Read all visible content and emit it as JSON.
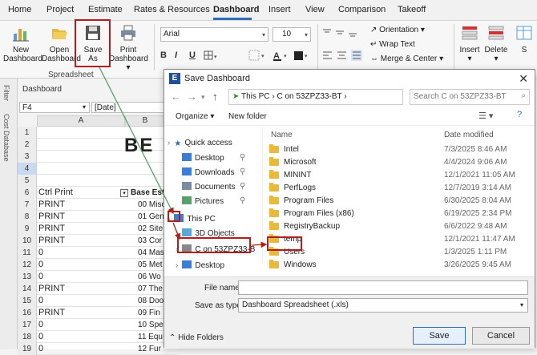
{
  "menu": {
    "tabs": [
      "Home",
      "Project",
      "Estimate",
      "Rates & Resources",
      "Dashboard",
      "Insert",
      "View",
      "Comparison",
      "Takeoff"
    ]
  },
  "ribbon": {
    "new_dashboard": "New\nDashboard",
    "new_line1": "New",
    "new_line2": "Dashboard",
    "open_line1": "Open",
    "open_line2": "Dashboard",
    "save_line1": "Save",
    "save_line2": "As",
    "print_line1": "Print",
    "print_line2": "Dashboard",
    "group_label": "Spreadsheet",
    "font_name": "Arial",
    "font_size": "10",
    "bold": "B",
    "italic": "I",
    "underline": "U",
    "orientation": "Orientation",
    "wrap_text": "Wrap Text",
    "merge_center": "Merge & Center",
    "insert": "Insert",
    "delete": "Delete",
    "extra": "S"
  },
  "sheet": {
    "sidebar_filter": "Filter",
    "sidebar_cost_db": "Cost Database",
    "tab_label": "Dashboard",
    "name_box": "F4",
    "formula": "[Date]",
    "col_a": "A",
    "col_b": "B",
    "big_text": "BE",
    "rows": [
      {
        "num": "1",
        "a": "",
        "b": ""
      },
      {
        "num": "2",
        "a": "",
        "b": ""
      },
      {
        "num": "3",
        "a": "",
        "b": ""
      },
      {
        "num": "4",
        "a": "",
        "b": ""
      },
      {
        "num": "5",
        "a": "",
        "b": ""
      },
      {
        "num": "6",
        "a": "Ctrl Print",
        "b": "Base Esti"
      },
      {
        "num": "7",
        "a": "PRINT",
        "b": "00 Misc"
      },
      {
        "num": "8",
        "a": "PRINT",
        "b": "01 Gen"
      },
      {
        "num": "9",
        "a": "PRINT",
        "b": "02 Site"
      },
      {
        "num": "10",
        "a": "PRINT",
        "b": "03 Cor"
      },
      {
        "num": "11",
        "a": "0",
        "b": "04 Mas"
      },
      {
        "num": "12",
        "a": "0",
        "b": "05 Met"
      },
      {
        "num": "13",
        "a": "0",
        "b": "06 Wo"
      },
      {
        "num": "14",
        "a": "PRINT",
        "b": "07 The"
      },
      {
        "num": "15",
        "a": "0",
        "b": "08 Doo"
      },
      {
        "num": "16",
        "a": "PRINT",
        "b": "09 Fin"
      },
      {
        "num": "17",
        "a": "0",
        "b": "10 Spe"
      },
      {
        "num": "18",
        "a": "0",
        "b": "11 Equ"
      },
      {
        "num": "19",
        "a": "0",
        "b": "12 Fur"
      }
    ]
  },
  "dialog": {
    "app_icon": "E",
    "title": "Save Dashboard",
    "close": "✕",
    "address": "This PC  ›  C on 53ZPZ33-BT  ›",
    "search_placeholder": "Search C on 53ZPZ33-BT",
    "organize": "Organize",
    "new_folder": "New folder",
    "nav": [
      {
        "label": "Quick access",
        "type": "star"
      },
      {
        "label": "Desktop",
        "type": "desktop"
      },
      {
        "label": "Downloads",
        "type": "down"
      },
      {
        "label": "Documents",
        "type": "doc"
      },
      {
        "label": "Pictures",
        "type": "pic"
      },
      {
        "label": "This PC",
        "type": "pc"
      },
      {
        "label": "3D Objects",
        "type": "obj"
      },
      {
        "label": "C on 53ZPZ33-B",
        "type": "drive"
      },
      {
        "label": "Desktop",
        "type": "desktop"
      }
    ],
    "col_name": "Name",
    "col_date": "Date modified",
    "files": [
      {
        "name": "Intel",
        "date": "7/3/2025 8:46 AM"
      },
      {
        "name": "Microsoft",
        "date": "4/4/2024 9:06 AM"
      },
      {
        "name": "MININT",
        "date": "12/1/2021 11:05 AM"
      },
      {
        "name": "PerfLogs",
        "date": "12/7/2019 3:14 AM"
      },
      {
        "name": "Program Files",
        "date": "6/30/2025 8:04 AM"
      },
      {
        "name": "Program Files (x86)",
        "date": "6/19/2025 2:34 PM"
      },
      {
        "name": "RegistryBackup",
        "date": "6/6/2022 9:48 AM"
      },
      {
        "name": "temp",
        "date": "12/1/2021 11:47 AM"
      },
      {
        "name": "Users",
        "date": "1/3/2025 1:11 PM"
      },
      {
        "name": "Windows",
        "date": "3/26/2025 9:45 AM"
      }
    ],
    "file_name_label": "File name:",
    "file_name_value": "",
    "save_type_label": "Save as type:",
    "save_type_value": "Dashboard Spreadsheet (.xls)",
    "hide_folders": "Hide Folders",
    "save": "Save",
    "cancel": "Cancel"
  },
  "colors": {
    "accent": "#2f6fb4",
    "highlight": "#b01e1e",
    "folder": "#e8b93a"
  }
}
